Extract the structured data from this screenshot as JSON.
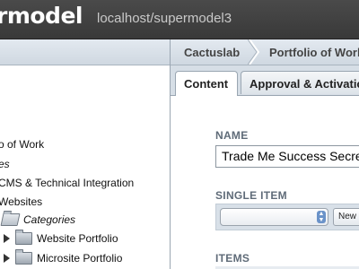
{
  "header": {
    "brand": "rmodel",
    "host": "localhost/supermodel3"
  },
  "breadcrumb": {
    "items": [
      "Cactuslab",
      "Portfolio of Work"
    ]
  },
  "tabs": [
    {
      "label": "Content",
      "active": true
    },
    {
      "label": "Approval & Activation",
      "active": false
    }
  ],
  "tree": {
    "items": [
      {
        "label": "o of Work",
        "italic": false
      },
      {
        "label": "es",
        "italic": true
      },
      {
        "label": "CMS & Technical Integration",
        "italic": false
      },
      {
        "label": "Websites",
        "italic": false
      },
      {
        "label": "Categories",
        "italic": true,
        "icon": "folder-open-icon"
      },
      {
        "label": "Website Portfolio",
        "italic": false,
        "icon": "folder-icon",
        "expandable": true
      },
      {
        "label": "Microsite Portfolio",
        "italic": false,
        "icon": "folder-icon",
        "expandable": true
      }
    ]
  },
  "form": {
    "name_label": "NAME",
    "name_value": "Trade Me Success Secrets",
    "single_item_label": "SINGLE ITEM",
    "single_item_value": "",
    "new_button": "New",
    "items_label": "ITEMS"
  },
  "colors": {
    "header_bg": "#3f3f3f",
    "pane_bg": "#d6dee6",
    "label_text": "#5f6b78"
  }
}
